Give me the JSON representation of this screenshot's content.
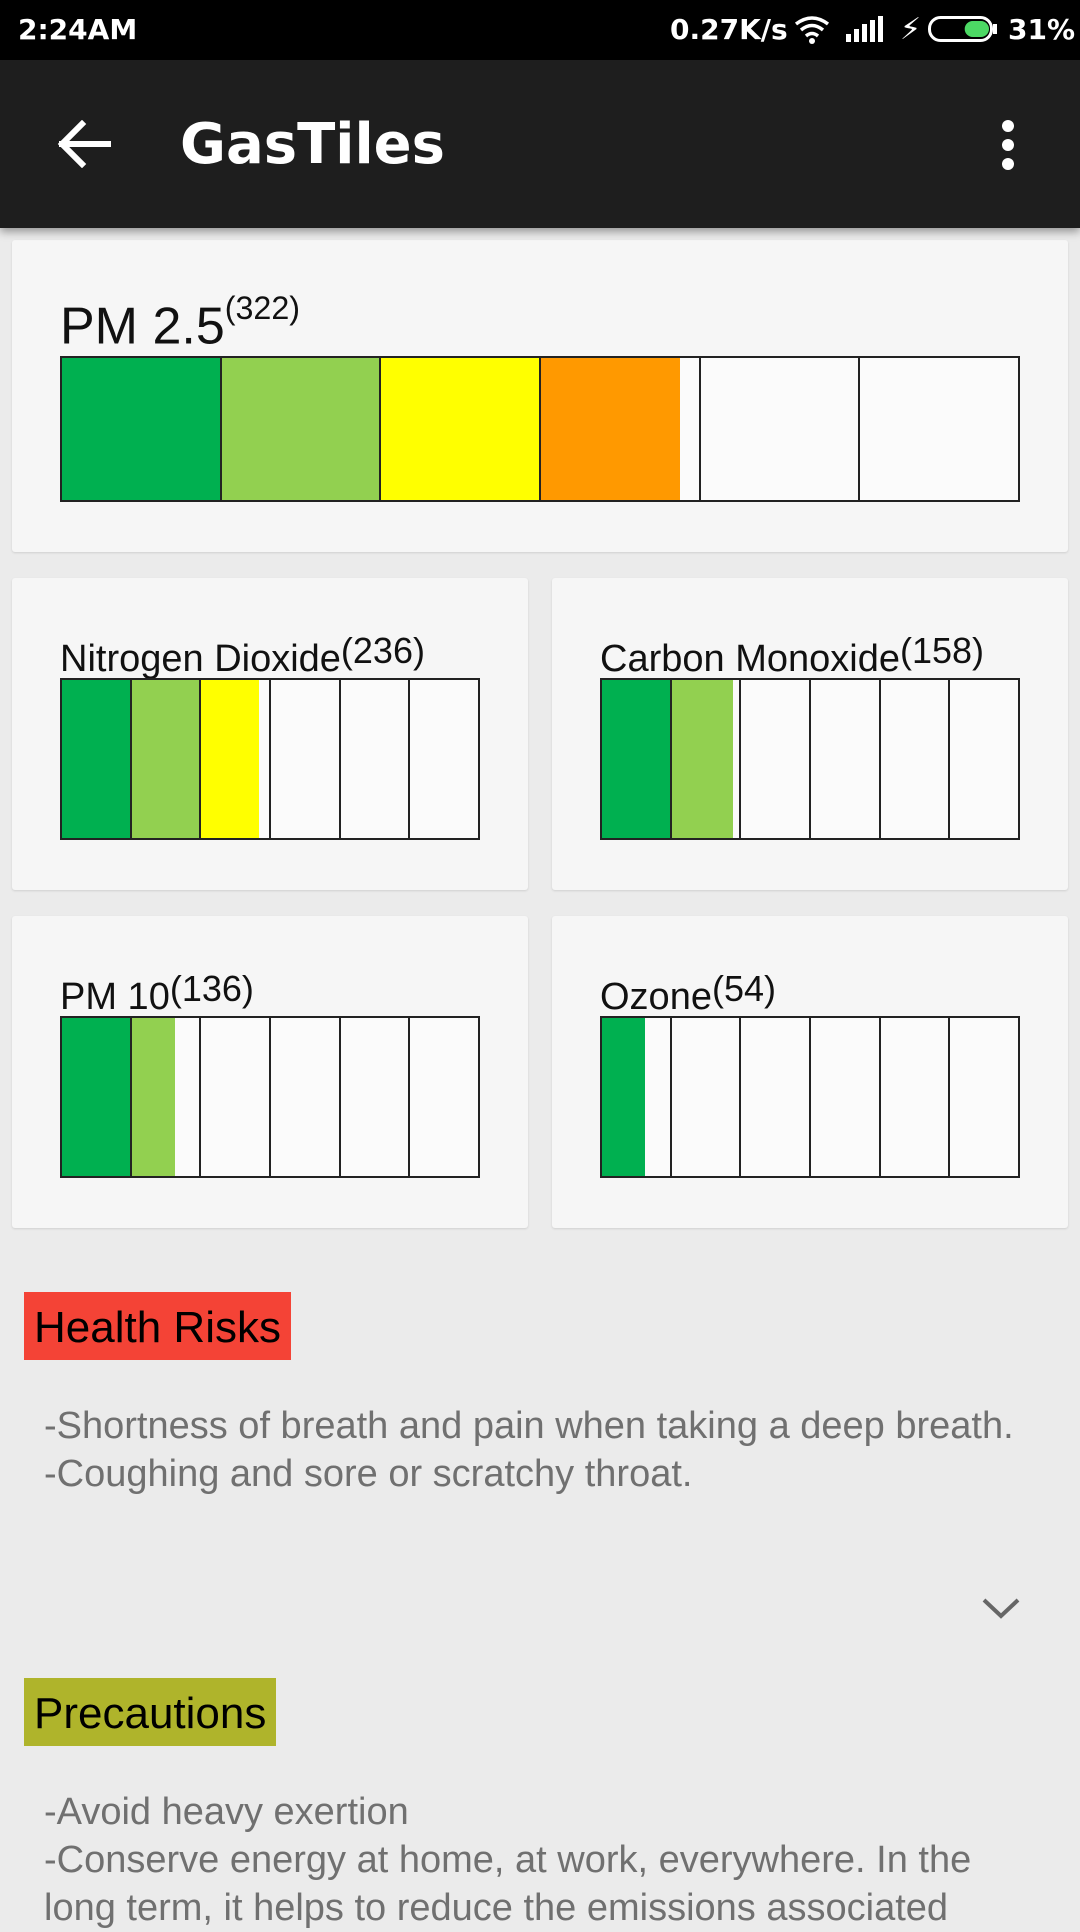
{
  "status_bar": {
    "time": "2:24AM",
    "speed": "0.27K/s",
    "battery_pct": "31%",
    "battery_level": 0.31,
    "icons": [
      "wifi-icon",
      "signal-icon",
      "charging-icon",
      "battery-icon"
    ]
  },
  "app_bar": {
    "title": "GasTiles",
    "back_icon": "arrow-left-icon",
    "menu_icon": "more-vertical-icon"
  },
  "scale_colors": [
    "#00b050",
    "#92d050",
    "#ffff00",
    "#ff9900",
    "#ff0000",
    "#7030a0"
  ],
  "gases": [
    {
      "name": "PM 2.5",
      "aqi": "(322)",
      "fill_segments": [
        1,
        1,
        1,
        0.88,
        0,
        0
      ]
    },
    {
      "name": "Nitrogen Dioxide",
      "aqi": "(236)",
      "fill_segments": [
        1,
        1,
        0.85,
        0,
        0,
        0
      ]
    },
    {
      "name": "Carbon Monoxide",
      "aqi": "(158)",
      "fill_segments": [
        1,
        0.9,
        0,
        0,
        0,
        0
      ]
    },
    {
      "name": "PM 10",
      "aqi": "(136)",
      "fill_segments": [
        1,
        0.64,
        0,
        0,
        0,
        0
      ]
    },
    {
      "name": "Ozone",
      "aqi": "(54)",
      "fill_segments": [
        0.64,
        0,
        0,
        0,
        0,
        0
      ]
    }
  ],
  "health_risks": {
    "title": "Health Risks",
    "color": "#f44336",
    "lines": [
      "-Shortness of breath and pain when taking a deep breath.",
      "-Coughing and sore or scratchy throat."
    ]
  },
  "precautions": {
    "title": "Precautions",
    "color": "#afb42b",
    "lines": [
      "-Avoid heavy exertion",
      "-Conserve energy at home, at work, everywhere. In the long term, it helps to reduce the emissions associated"
    ]
  }
}
